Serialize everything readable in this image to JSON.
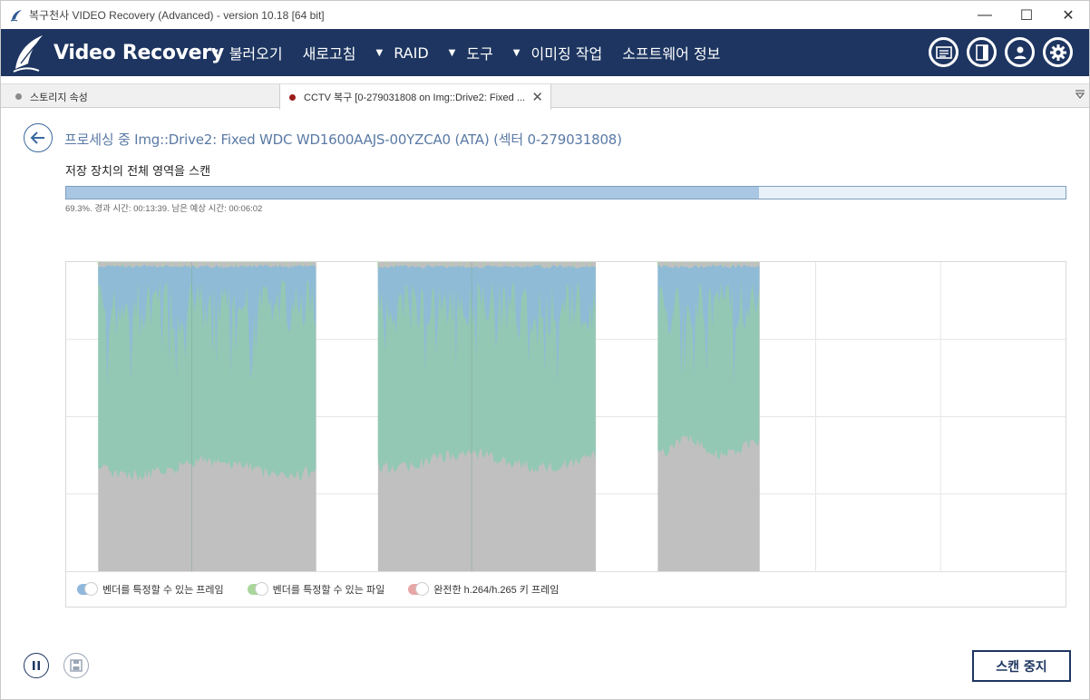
{
  "window": {
    "title": "복구천사 VIDEO Recovery (Advanced) - version 10.18 [64 bit]",
    "minimize": "—",
    "maximize": "☐",
    "close": "✕"
  },
  "header": {
    "brand": "Video Recovery",
    "nav": [
      {
        "label": "불러오기",
        "caret": "▼"
      },
      {
        "label": "새로고침",
        "caret": ""
      },
      {
        "label": "RAID",
        "caret": "▼"
      },
      {
        "label": "도구",
        "caret": "▼"
      },
      {
        "label": "이미징 작업",
        "caret": "▼"
      },
      {
        "label": "소프트웨어 정보",
        "caret": ""
      }
    ],
    "icons": [
      "log-icon",
      "panel-icon",
      "user-icon",
      "settings-icon"
    ]
  },
  "tabs": [
    {
      "label": "스토리지 속성",
      "dot_color": "#8a8a8a"
    },
    {
      "label": "CCTV 복구 [0-279031808 on Img::Drive2: Fixed ...",
      "dot_color": "#9a1c1c",
      "close": "✕"
    }
  ],
  "tab_menu": "⩢",
  "process": {
    "title": "프로세싱 중 Img::Drive2: Fixed WDC WD1600AAJS-00YZCA0 (ATA) (섹터 0-279031808)",
    "subtitle": "저장 장치의 전체 영역을 스캔",
    "progress": 0.693,
    "progress_text": "69.3%. 경과 시간: 00:13:39. 남은 예상 시간: 00:06:02"
  },
  "chart_data": {
    "type": "area",
    "series": [
      {
        "name": "벤더를 특정할 수 있는 프레임",
        "color": "#8fb8dc"
      },
      {
        "name": "벤더를 특정할 수 있는 파일",
        "color": "#93c8b4"
      },
      {
        "name": "완전한 h.264/h.265 키 프레임",
        "color": "#e8a7a7"
      }
    ],
    "background_color": "#c0c0c0",
    "blocks": [
      {
        "start": 0.032,
        "end": 0.25
      },
      {
        "start": 0.312,
        "end": 0.53
      },
      {
        "start": 0.592,
        "end": 0.694
      }
    ],
    "grid": true
  },
  "legend": {
    "item1": "벤더를 특정할 수 있는 프레임",
    "item2": "벤더를 특정할 수 있는 파일",
    "item3": "완전한 h.264/h.265 키 프레임"
  },
  "footer": {
    "stop_label": "스캔 중지"
  },
  "colors": {
    "header_bg": "#1d3560",
    "progress_fill": "#a9c6e2",
    "accent": "#3a6aa0"
  }
}
